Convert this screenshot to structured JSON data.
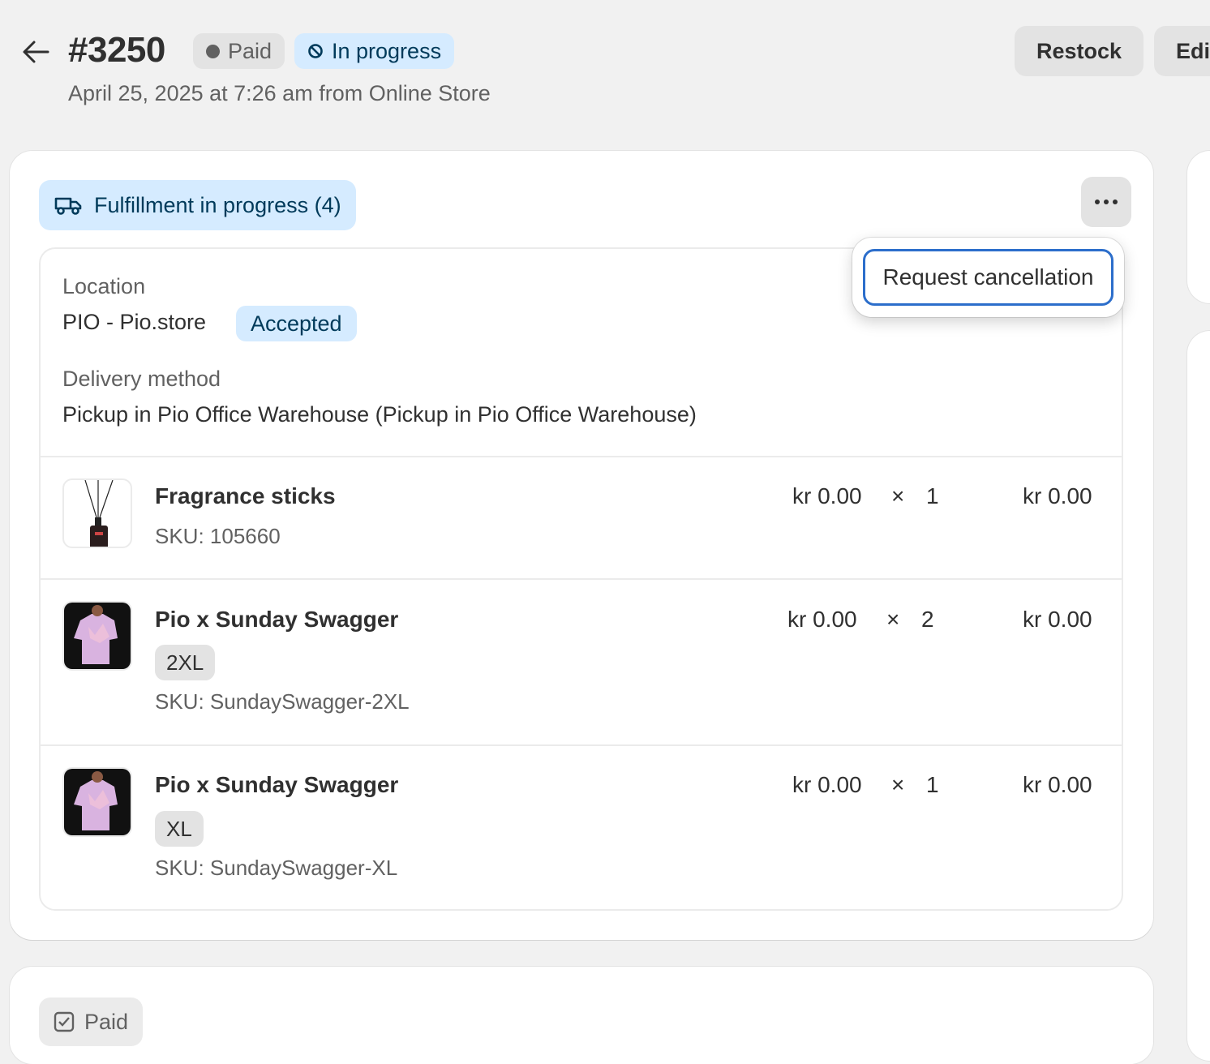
{
  "header": {
    "order_number": "#3250",
    "payment_status": "Paid",
    "fulfillment_status": "In progress",
    "subtitle": "April 25, 2025 at 7:26 am from Online Store",
    "restock_label": "Restock",
    "edit_label": "Edit"
  },
  "fulfillment": {
    "badge": "Fulfillment in progress (4)",
    "location_label": "Location",
    "location_value": "PIO - Pio.store",
    "location_status": "Accepted",
    "delivery_label": "Delivery method",
    "delivery_value": "Pickup in Pio Office Warehouse (Pickup in Pio Office Warehouse)",
    "items": [
      {
        "name": "Fragrance sticks",
        "variant": "",
        "sku": "SKU: 105660",
        "unit_price": "kr 0.00",
        "times": "×",
        "qty": "1",
        "total": "kr 0.00",
        "thumb_icon": "diffuser-image"
      },
      {
        "name": "Pio x Sunday Swagger",
        "variant": "2XL",
        "sku": "SKU: SundaySwagger-2XL",
        "unit_price": "kr 0.00",
        "times": "×",
        "qty": "2",
        "total": "kr 0.00",
        "thumb_icon": "shirt-image"
      },
      {
        "name": "Pio x Sunday Swagger",
        "variant": "XL",
        "sku": "SKU: SundaySwagger-XL",
        "unit_price": "kr 0.00",
        "times": "×",
        "qty": "1",
        "total": "kr 0.00",
        "thumb_icon": "shirt-image"
      }
    ]
  },
  "popover": {
    "item_label": "Request cancellation"
  },
  "payment_card": {
    "badge": "Paid"
  },
  "colors": {
    "accent_blue": "#2c6ecb",
    "info_bg": "#d5ebff",
    "info_text": "#003a5a"
  }
}
